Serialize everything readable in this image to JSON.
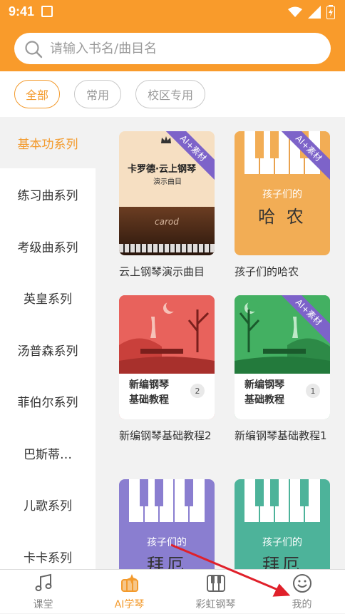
{
  "status": {
    "time": "9:41"
  },
  "search": {
    "placeholder": "请输入书名/曲目名"
  },
  "filters": [
    {
      "label": "全部",
      "active": true
    },
    {
      "label": "常用",
      "active": false
    },
    {
      "label": "校区专用",
      "active": false
    }
  ],
  "sidebar": {
    "items": [
      {
        "label": "基本功系列",
        "active": true
      },
      {
        "label": "练习曲系列"
      },
      {
        "label": "考级曲系列"
      },
      {
        "label": "英皇系列"
      },
      {
        "label": "汤普森系列"
      },
      {
        "label": "菲伯尔系列"
      },
      {
        "label": "巴斯蒂…"
      },
      {
        "label": "儿歌系列"
      },
      {
        "label": "卡卡系列"
      }
    ]
  },
  "books": [
    {
      "title": "云上钢琴演示曲目",
      "ribbon": "AI+素材",
      "cover_line1": "卡罗德·云上钢琴",
      "cover_line2": "演示曲目",
      "brand": "carod"
    },
    {
      "title": "孩子们的哈农",
      "ribbon": "AI+素材",
      "cover_line1": "孩子们的",
      "cover_line2": "哈 农"
    },
    {
      "title": "新编钢琴基础教程2",
      "cover_label": "新编钢琴\n基础教程",
      "badge": "2"
    },
    {
      "title": "新编钢琴基础教程1",
      "ribbon": "AI+素材",
      "cover_label": "新编钢琴\n基础教程",
      "badge": "1"
    },
    {
      "title": "",
      "cover_line1": "孩子们的",
      "cover_line2": "拜厄"
    },
    {
      "title": "",
      "cover_line1": "孩子们的",
      "cover_line2": "拜厄"
    }
  ],
  "tabs": [
    {
      "label": "课堂",
      "icon": "music-note-icon"
    },
    {
      "label": "AI学琴",
      "icon": "ai-piano-icon",
      "active": true
    },
    {
      "label": "彩虹钢琴",
      "icon": "piano-keys-icon"
    },
    {
      "label": "我的",
      "icon": "smiley-icon"
    }
  ],
  "colors": {
    "accent": "#f99b2b",
    "ribbon": "#7d63c9",
    "annotation_arrow": "#e0202a"
  }
}
